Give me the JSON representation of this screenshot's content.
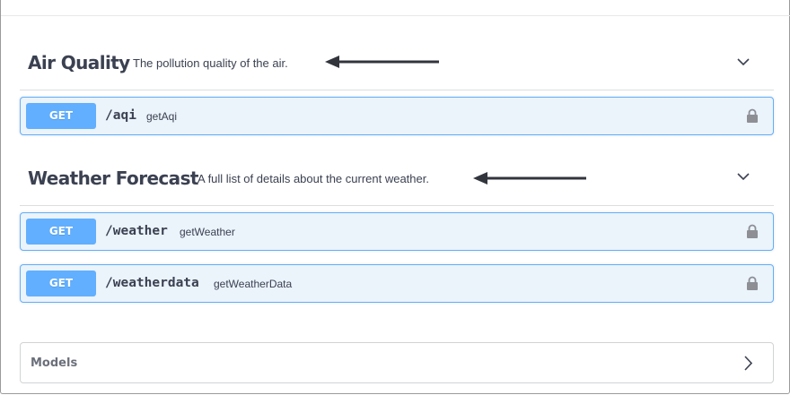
{
  "tags": [
    {
      "name": "Air Quality",
      "description": "The pollution quality of the air.",
      "operations": [
        {
          "method": "GET",
          "path": "/aqi",
          "summary": "getAqi"
        }
      ]
    },
    {
      "name": "Weather Forecast",
      "description": "A full list of details about the current weather.",
      "operations": [
        {
          "method": "GET",
          "path": "/weather",
          "summary": "getWeather"
        },
        {
          "method": "GET",
          "path": "/weatherdata",
          "summary": "getWeatherData"
        }
      ]
    }
  ],
  "models": {
    "label": "Models"
  },
  "icons": {
    "collapse": "chevron-down-icon",
    "expand": "chevron-right-icon",
    "lock": "lock-icon",
    "pointer": "arrow-left-icon"
  },
  "colors": {
    "get_method": "#61affe",
    "get_block_bg": "#ebf3fb",
    "text": "#3b4151",
    "arrow": "#33353d"
  }
}
